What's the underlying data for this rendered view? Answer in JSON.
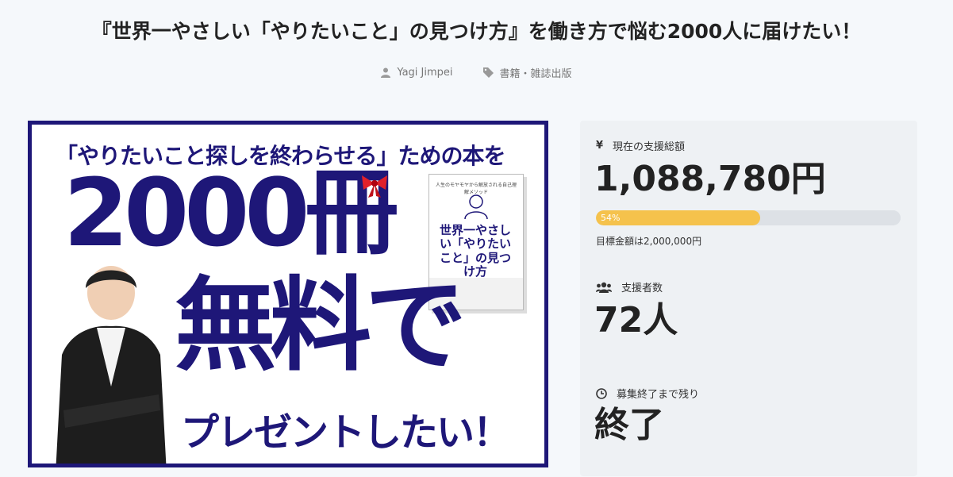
{
  "project": {
    "title": "『世界一やさしい「やりたいこと」の見つけ方』を働き方で悩む2000人に届けたい！",
    "author": "Yagi Jimpei",
    "category": "書籍・雑誌出版",
    "author_icon": "user-icon",
    "category_icon": "tag-icon"
  },
  "hero": {
    "headline": "「やりたいこと探しを終わらせる」ための本を",
    "big": "2000冊",
    "free": "無料で",
    "present": "プレゼントしたい！",
    "book_small": "人生のモヤモヤから解放される自己理解メソッド",
    "book_title": "世界一やさしい「やりたいこと」の見つけ方"
  },
  "stats": {
    "total": {
      "icon": "yen-icon",
      "label": "現在の支援総額",
      "value": "1,088,780円",
      "progress_percent": 54,
      "progress_label": "54%",
      "goal": "目標金額は2,000,000円"
    },
    "supporters": {
      "icon": "users-icon",
      "label": "支援者数",
      "value": "72人"
    },
    "remaining": {
      "icon": "clock-icon",
      "label": "募集終了まで残り",
      "value": "終了"
    }
  },
  "colors": {
    "brand_navy": "#1e1778",
    "progress": "#f5c24c",
    "panel_bg": "#eef1f4"
  }
}
